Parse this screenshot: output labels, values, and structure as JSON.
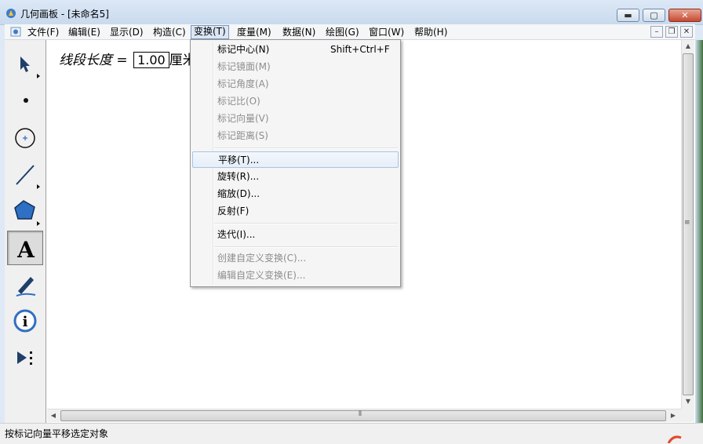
{
  "window": {
    "title": "几何画板 - [未命名5]",
    "min_glyph": "▬",
    "max_glyph": "▢",
    "close_glyph": "✕"
  },
  "menubar": {
    "items": [
      {
        "label": "文件(F)"
      },
      {
        "label": "编辑(E)"
      },
      {
        "label": "显示(D)"
      },
      {
        "label": "构造(C)"
      },
      {
        "label": "变换(T)",
        "active": true
      },
      {
        "label": "度量(M)"
      },
      {
        "label": "数据(N)"
      },
      {
        "label": "绘图(G)"
      },
      {
        "label": "窗口(W)"
      },
      {
        "label": "帮助(H)"
      }
    ],
    "mdi_min": "–",
    "mdi_restore": "❐",
    "mdi_close": "✕"
  },
  "toolbox": {
    "tools": [
      {
        "name": "arrow-select-tool",
        "icon": "arrow-cursor-icon"
      },
      {
        "name": "point-tool",
        "icon": "point-icon"
      },
      {
        "name": "compass-tool",
        "icon": "circle-icon"
      },
      {
        "name": "straightedge-tool",
        "icon": "line-segment-icon"
      },
      {
        "name": "polygon-tool",
        "icon": "polygon-icon"
      },
      {
        "name": "text-tool",
        "icon": "text-a-icon",
        "selected": true
      },
      {
        "name": "marker-tool",
        "icon": "marker-pen-icon"
      },
      {
        "name": "info-tool",
        "icon": "info-icon"
      },
      {
        "name": "custom-tool",
        "icon": "custom-tool-icon"
      }
    ]
  },
  "canvas": {
    "measure_label": "线段长度",
    "measure_equals": " = ",
    "measure_value": "1.00",
    "measure_unit": "厘米"
  },
  "dropdown": {
    "items": [
      {
        "label": "标记中心(N)",
        "shortcut": "Shift+Ctrl+F",
        "enabled": true
      },
      {
        "label": "标记镜面(M)",
        "shortcut": "",
        "enabled": false
      },
      {
        "label": "标记角度(A)",
        "shortcut": "",
        "enabled": false
      },
      {
        "label": "标记比(O)",
        "shortcut": "",
        "enabled": false
      },
      {
        "label": "标记向量(V)",
        "shortcut": "",
        "enabled": false
      },
      {
        "label": "标记距离(S)",
        "shortcut": "",
        "enabled": false
      },
      {
        "label": "平移(T)...",
        "shortcut": "",
        "enabled": true,
        "hover": true
      },
      {
        "label": "旋转(R)...",
        "shortcut": "",
        "enabled": true
      },
      {
        "label": "缩放(D)...",
        "shortcut": "",
        "enabled": true
      },
      {
        "label": "反射(F)",
        "shortcut": "",
        "enabled": true
      },
      {
        "label": "迭代(I)...",
        "shortcut": "",
        "enabled": true
      },
      {
        "label": "创建自定义变换(C)...",
        "shortcut": "",
        "enabled": false
      },
      {
        "label": "编辑自定义变换(E)...",
        "shortcut": "",
        "enabled": false
      }
    ]
  },
  "scrollbars": {
    "up_glyph": "▲",
    "down_glyph": "▼",
    "left_glyph": "◀",
    "right_glyph": "▶",
    "grip": "≡",
    "hgrip": "⦀"
  },
  "statusbar": {
    "text": "按标记向量平移选定对象"
  },
  "colors": {
    "accent": "#7a96bd",
    "disabled_text": "#8d8d8d",
    "tool_blue": "#2f6fc4"
  }
}
